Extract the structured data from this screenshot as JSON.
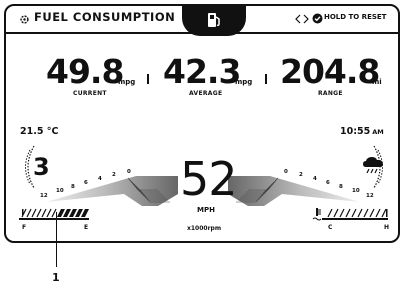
{
  "header": {
    "title": "FUEL CONSUMPTION",
    "hint": "HOLD TO RESET"
  },
  "stats": [
    {
      "value": "49.8",
      "unit": "mpg",
      "label": "CURRENT"
    },
    {
      "value": "42.3",
      "unit": "mpg",
      "label": "AVERAGE"
    },
    {
      "value": "204.8",
      "unit": "mi",
      "label": "RANGE"
    }
  ],
  "temperature": "21.5 °C",
  "clock": {
    "time": "10:55",
    "period": "AM"
  },
  "gear": "3",
  "speed": {
    "value": "52",
    "unit": "MPH"
  },
  "rpm_label": "x1000rpm",
  "rpm_ticks_left": [
    "12",
    "10",
    "8",
    "6",
    "4",
    "2",
    "0"
  ],
  "rpm_ticks_right": [
    "0",
    "2",
    "4",
    "6",
    "8",
    "10",
    "12"
  ],
  "fuel_gauge": {
    "empty": "E",
    "full": "F"
  },
  "temp_gauge": {
    "cold": "C",
    "hot": "H"
  },
  "callout": "1",
  "icons": [
    "settings-icon",
    "fuel-pump-icon",
    "chevron-left-icon",
    "chevron-right-icon",
    "check-circle-icon",
    "weather-icon",
    "coolant-temp-icon"
  ]
}
